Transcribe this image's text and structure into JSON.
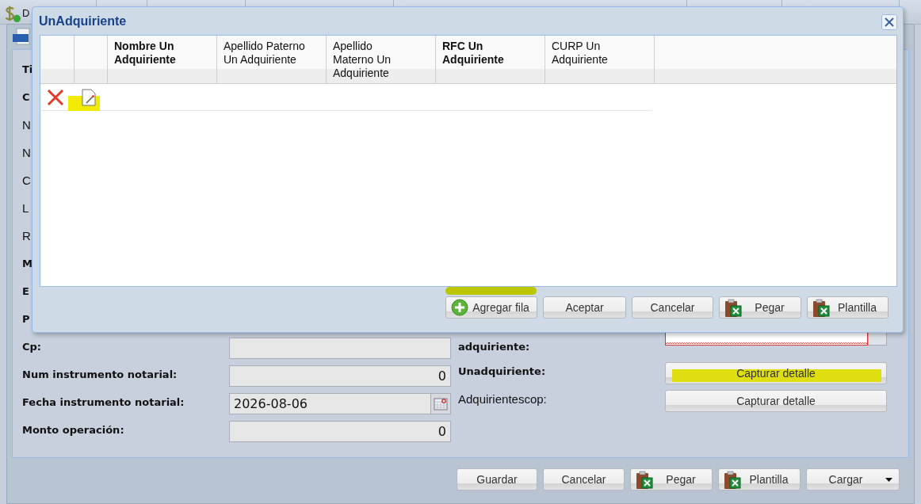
{
  "toolbar": {
    "label": "D"
  },
  "form_window": {
    "fields": [
      {
        "label": "Ti",
        "bold": true,
        "kind": "cut"
      },
      {
        "label": "C",
        "bold": true,
        "kind": "cut"
      },
      {
        "label": "N",
        "bold": false,
        "kind": "cut"
      },
      {
        "label": "N",
        "bold": false,
        "kind": "cut"
      },
      {
        "label": "C",
        "bold": false,
        "kind": "cut"
      },
      {
        "label": "L",
        "bold": false,
        "kind": "cut"
      },
      {
        "label": "R",
        "bold": false,
        "kind": "cut"
      },
      {
        "label": "M",
        "bold": true,
        "kind": "cut"
      },
      {
        "label": "E",
        "bold": true,
        "kind": "cut"
      },
      {
        "label": "P",
        "bold": true,
        "kind": "cut"
      },
      {
        "label": "Cp:",
        "bold": true,
        "kind": "text"
      },
      {
        "label": "Num instrumento notarial:",
        "bold": true,
        "kind": "number",
        "value": "0"
      },
      {
        "label": "Fecha instrumento notarial:",
        "bold": true,
        "kind": "date",
        "value": "2026-08-06"
      },
      {
        "label": "Monto operación:",
        "bold": true,
        "kind": "number",
        "value": "0"
      }
    ],
    "right_fields": [
      {
        "label": "adquiriente:",
        "bold": true,
        "kind": "combo",
        "invalid": true
      },
      {
        "label": "Unadquiriente:",
        "bold": true,
        "kind": "detail",
        "button": "Capturar detalle",
        "highlighted": true
      },
      {
        "label": "Adquirientescop:",
        "bold": false,
        "kind": "detail",
        "button": "Capturar detalle",
        "highlighted": false
      }
    ],
    "buttons": [
      {
        "label": "Guardar",
        "kind": "plain"
      },
      {
        "label": "Cancelar",
        "kind": "plain"
      },
      {
        "label": "Pegar",
        "kind": "excel"
      },
      {
        "label": "Plantilla",
        "kind": "excel"
      },
      {
        "label": "Cargar",
        "kind": "dropdown"
      }
    ]
  },
  "dialog": {
    "title": "UnAdquiriente",
    "columns": [
      {
        "label": "Nombre Un Adquiriente",
        "bold": true
      },
      {
        "label": "Apellido Paterno Un Adquiriente",
        "bold": false
      },
      {
        "label": "Apellido Materno Un Adquiriente",
        "bold": false
      },
      {
        "label": "RFC Un Adquiriente",
        "bold": true
      },
      {
        "label": "CURP Un Adquiriente",
        "bold": false
      }
    ],
    "rows": [
      {
        "edit_highlighted": true
      }
    ],
    "buttons": [
      {
        "label": "Agregar fila",
        "kind": "add",
        "highlighted": true
      },
      {
        "label": "Aceptar",
        "kind": "plain",
        "highlighted": false
      },
      {
        "label": "Cancelar",
        "kind": "plain",
        "highlighted": false
      },
      {
        "label": "Pegar",
        "kind": "excel",
        "highlighted": false
      },
      {
        "label": "Plantilla",
        "kind": "excel",
        "highlighted": false
      }
    ]
  }
}
